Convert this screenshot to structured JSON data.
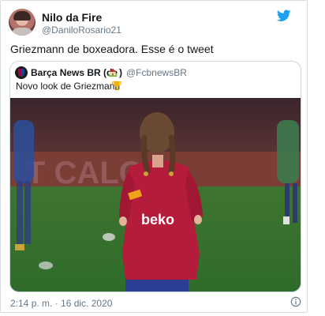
{
  "tweet": {
    "author": {
      "display_name": "Nilo da Fire",
      "handle": "@DaniloRosario21"
    },
    "text": "Griezmann de boxeadora. Esse é o tweet",
    "timestamp": "2:14 p. m. · 16 dic. 2020",
    "icons": {
      "brand": "twitter-bird-icon",
      "info": "info-icon"
    },
    "colors": {
      "brand": "#1da1f2",
      "text": "#14171a",
      "muted": "#657786",
      "border": "#ccd6dd"
    }
  },
  "quoted_tweet": {
    "author": {
      "display_name": "Barça News BR (de",
      "display_name_suffix": ")",
      "emoji_icon": "house-emoji-icon",
      "handle": "@FcbnewsBR"
    },
    "text": "Novo look de Griezmann",
    "text_emoji_icon": "trophy-emoji-icon",
    "photo": {
      "shirt_sponsor": "beko",
      "stand_lettering": "T CALO",
      "colors": {
        "shirt": "#b51b3a",
        "shorts": "#2c3e94",
        "pitch": "#3e7f31",
        "stands": "#5e3a35"
      }
    }
  }
}
